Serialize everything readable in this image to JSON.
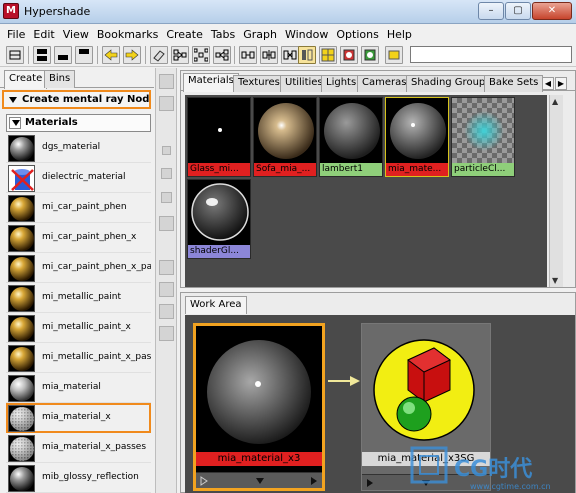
{
  "window": {
    "title": "Hypershade",
    "icon": "maya-app-icon"
  },
  "winbuttons": {
    "minimize": "–",
    "maximize": "▢",
    "close": "✕"
  },
  "menu": [
    "File",
    "Edit",
    "View",
    "Bookmarks",
    "Create",
    "Tabs",
    "Graph",
    "Window",
    "Options",
    "Help"
  ],
  "toolbar": {
    "search_value": ""
  },
  "left": {
    "tabs": [
      "Create",
      "Bins"
    ],
    "mental_ray_header": "Create mental ray Nodes",
    "materials_header": "Materials",
    "nodes": [
      {
        "label": "dgs_material",
        "swatch": "grey-sphere"
      },
      {
        "label": "dielectric_material",
        "swatch": "dielectric"
      },
      {
        "label": "mi_car_paint_phen",
        "swatch": "gold-sphere"
      },
      {
        "label": "mi_car_paint_phen_x",
        "swatch": "gold-sphere"
      },
      {
        "label": "mi_car_paint_phen_x_pa",
        "swatch": "gold-sphere"
      },
      {
        "label": "mi_metallic_paint",
        "swatch": "gold-sphere"
      },
      {
        "label": "mi_metallic_paint_x",
        "swatch": "gold-sphere"
      },
      {
        "label": "mi_metallic_paint_x_pass",
        "swatch": "gold-sphere"
      },
      {
        "label": "mia_material",
        "swatch": "chrome-sphere"
      },
      {
        "label": "mia_material_x",
        "swatch": "chrome-sphere"
      },
      {
        "label": "mia_material_x_passes",
        "swatch": "chrome-sphere"
      },
      {
        "label": "mib_glossy_reflection",
        "swatch": "grey-sphere"
      }
    ]
  },
  "upper": {
    "tabs": [
      "Materials",
      "Textures",
      "Utilities",
      "Lights",
      "Cameras",
      "Shading Groups",
      "Bake Sets"
    ],
    "swatches": [
      {
        "label": "Glass_mi...",
        "kind": "glass"
      },
      {
        "label": "Sofa_mia_...",
        "kind": "sofa"
      },
      {
        "label": "lambert1",
        "kind": "lambert"
      },
      {
        "label": "mia_mate...",
        "kind": "mia"
      },
      {
        "label": "particleCl...",
        "kind": "particle"
      },
      {
        "label": "shaderGl...",
        "kind": "shaderglow"
      }
    ]
  },
  "work": {
    "tab": "Work Area",
    "node1_label": "mia_material_x3",
    "node2_label": "mia_material_x3SG"
  },
  "watermark": {
    "text": "CG时代",
    "url": "www.cgtime.com.cn"
  },
  "colors": {
    "highlight": "#f08a1c",
    "caption_red": "#e02020",
    "caption_green": "#8fcf7a",
    "caption_purple": "#8c86d8",
    "grid_bg": "#4a4a4a"
  }
}
